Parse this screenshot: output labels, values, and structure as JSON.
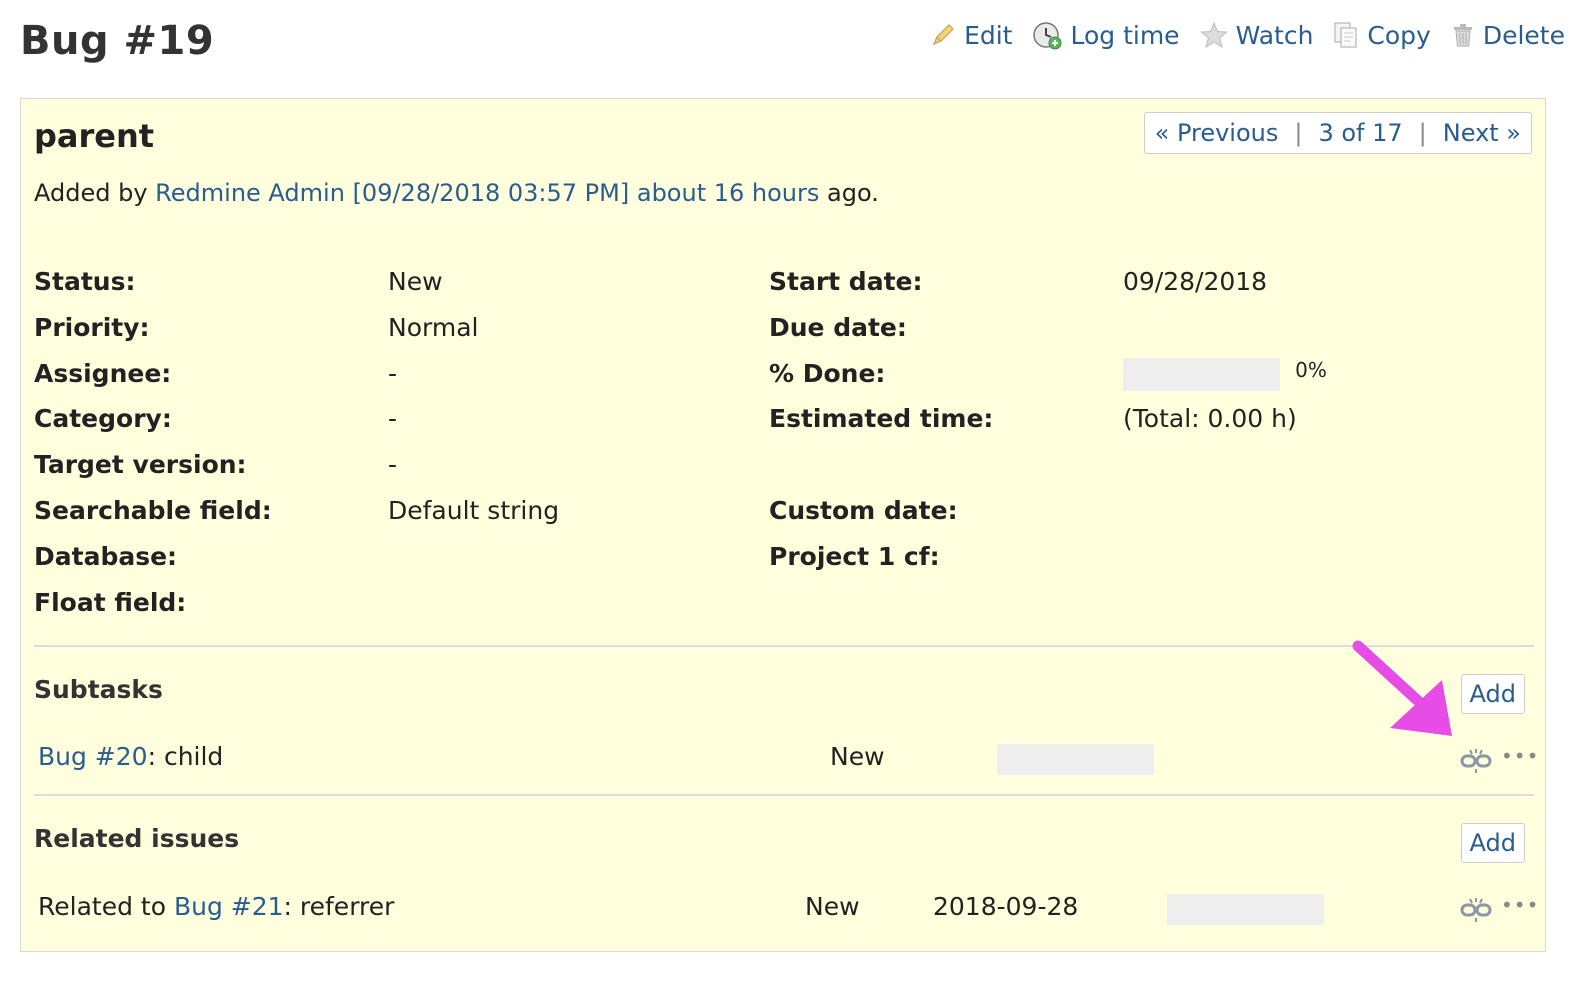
{
  "header": {
    "title": "Bug #19",
    "actions": [
      {
        "label": "Edit",
        "icon": "pencil-icon"
      },
      {
        "label": "Log time",
        "icon": "clock-icon"
      },
      {
        "label": "Watch",
        "icon": "star-icon"
      },
      {
        "label": "Copy",
        "icon": "copy-icon"
      },
      {
        "label": "Delete",
        "icon": "trash-icon"
      }
    ]
  },
  "issue": {
    "subject": "parent",
    "nav": {
      "previous": "« Previous",
      "position": "3 of 17",
      "next": "Next »",
      "separator": "|"
    },
    "author": {
      "prefix": "Added by",
      "name": "Redmine Admin",
      "timestamp": "[09/28/2018 03:57 PM]",
      "relative": "about 16 hours",
      "suffix": "ago."
    },
    "attributes_left": [
      {
        "label": "Status:",
        "value": "New"
      },
      {
        "label": "Priority:",
        "value": "Normal"
      },
      {
        "label": "Assignee:",
        "value": "-"
      },
      {
        "label": "Category:",
        "value": "-"
      },
      {
        "label": "Target version:",
        "value": "-"
      },
      {
        "label": "Searchable field:",
        "value": "Default string"
      },
      {
        "label": "Database:",
        "value": ""
      },
      {
        "label": "Float field:",
        "value": ""
      }
    ],
    "attributes_right": {
      "start_date": {
        "label": "Start date:",
        "value": "09/28/2018"
      },
      "due_date": {
        "label": "Due date:",
        "value": ""
      },
      "done": {
        "label": "% Done:",
        "value": "0%",
        "fraction": 0
      },
      "estimated": {
        "label": "Estimated time:",
        "value": "(Total: 0.00 h)"
      },
      "custom_date": {
        "label": "Custom date:",
        "value": ""
      },
      "project_cf": {
        "label": "Project 1 cf:",
        "value": ""
      }
    }
  },
  "subtasks": {
    "title": "Subtasks",
    "add_label": "Add",
    "items": [
      {
        "link": "Bug #20",
        "text": ": child",
        "status": "New",
        "progress": 0
      }
    ]
  },
  "related": {
    "title": "Related issues",
    "add_label": "Add",
    "items": [
      {
        "prefix": "Related to",
        "link": "Bug #21",
        "text": ": referrer",
        "status": "New",
        "date": "2018-09-28",
        "progress": 0
      }
    ]
  },
  "row_actions": {
    "unlink_icon": "unlink-icon",
    "more_icon": "ellipsis-icon",
    "more_label": "•••"
  },
  "colors": {
    "link": "#2a5d8f",
    "box_background": "#ffffdd",
    "annotation_arrow": "#e64ce6"
  }
}
